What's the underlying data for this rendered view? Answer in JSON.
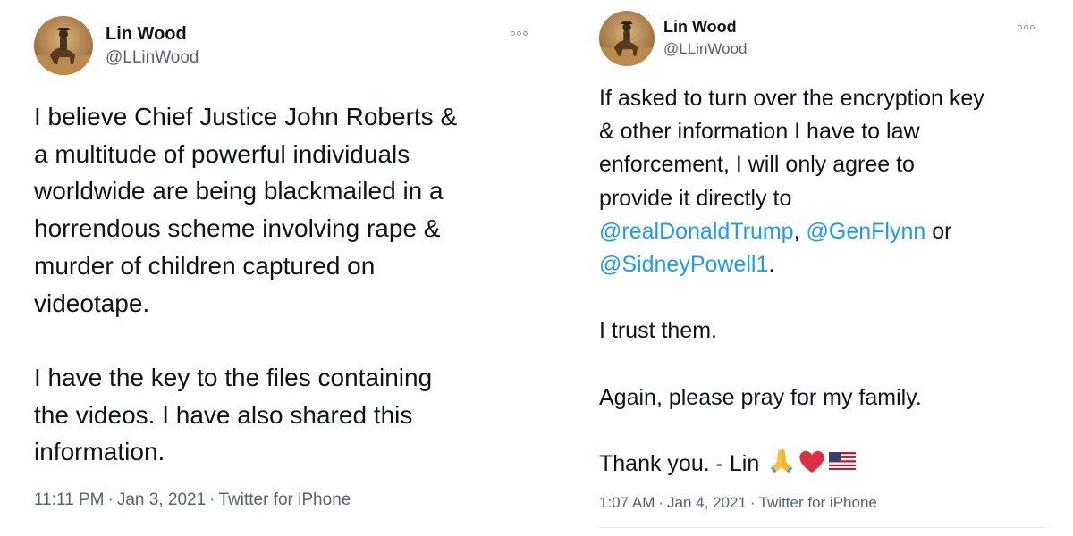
{
  "tweets": [
    {
      "author_name": "Lin Wood",
      "author_handle": "@LLinWood",
      "body": {
        "line1": "I believe Chief Justice John Roberts &",
        "line2": "a multitude of powerful individuals",
        "line3": "worldwide are being blackmailed in a",
        "line4": "horrendous scheme involving rape &",
        "line5": "murder of children captured on",
        "line6": "videotape.",
        "line7": "I have the key to the files containing",
        "line8": "the videos. I have also shared this",
        "line9": "information."
      },
      "time": "11:11 PM",
      "date": "Jan 3, 2021",
      "source": "Twitter for iPhone"
    },
    {
      "author_name": "Lin Wood",
      "author_handle": "@LLinWood",
      "body": {
        "line1": "If asked to turn over the encryption key",
        "line2": "& other information I have to law",
        "line3": "enforcement, I will only agree to",
        "line4": "provide it directly to",
        "mention1": "@realDonaldTrump",
        "sep1": ", ",
        "mention2": "@GenFlynn",
        "sep2": " or",
        "mention3": "@SidneyPowell1",
        "sep3": ".",
        "line7": "I trust them.",
        "line8": "Again, please pray for my family.",
        "line9": "Thank you. - Lin"
      },
      "emojis": [
        "folded-hands-icon",
        "red-heart-icon",
        "us-flag-icon"
      ],
      "time": "1:07 AM",
      "date": "Jan 4, 2021",
      "source": "Twitter for iPhone"
    }
  ],
  "colors": {
    "text": "#0f1419",
    "secondary": "#536471",
    "mention": "#1d9bf0"
  },
  "meta_separator": "·"
}
